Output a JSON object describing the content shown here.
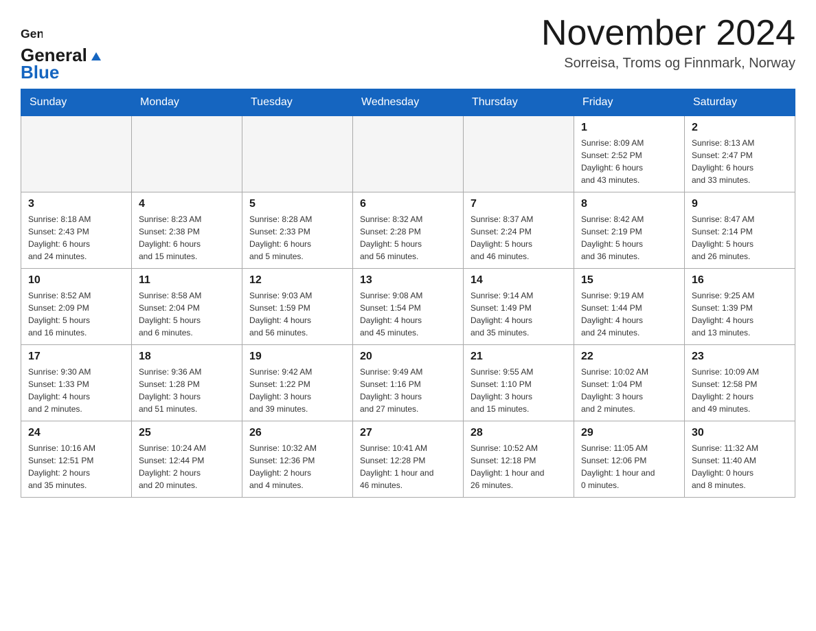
{
  "header": {
    "logo_general": "General",
    "logo_blue": "Blue",
    "month_title": "November 2024",
    "subtitle": "Sorreisa, Troms og Finnmark, Norway"
  },
  "weekdays": [
    "Sunday",
    "Monday",
    "Tuesday",
    "Wednesday",
    "Thursday",
    "Friday",
    "Saturday"
  ],
  "weeks": [
    {
      "days": [
        {
          "num": "",
          "info": "",
          "empty": true
        },
        {
          "num": "",
          "info": "",
          "empty": true
        },
        {
          "num": "",
          "info": "",
          "empty": true
        },
        {
          "num": "",
          "info": "",
          "empty": true
        },
        {
          "num": "",
          "info": "",
          "empty": true
        },
        {
          "num": "1",
          "info": "Sunrise: 8:09 AM\nSunset: 2:52 PM\nDaylight: 6 hours\nand 43 minutes.",
          "empty": false
        },
        {
          "num": "2",
          "info": "Sunrise: 8:13 AM\nSunset: 2:47 PM\nDaylight: 6 hours\nand 33 minutes.",
          "empty": false
        }
      ]
    },
    {
      "days": [
        {
          "num": "3",
          "info": "Sunrise: 8:18 AM\nSunset: 2:43 PM\nDaylight: 6 hours\nand 24 minutes.",
          "empty": false
        },
        {
          "num": "4",
          "info": "Sunrise: 8:23 AM\nSunset: 2:38 PM\nDaylight: 6 hours\nand 15 minutes.",
          "empty": false
        },
        {
          "num": "5",
          "info": "Sunrise: 8:28 AM\nSunset: 2:33 PM\nDaylight: 6 hours\nand 5 minutes.",
          "empty": false
        },
        {
          "num": "6",
          "info": "Sunrise: 8:32 AM\nSunset: 2:28 PM\nDaylight: 5 hours\nand 56 minutes.",
          "empty": false
        },
        {
          "num": "7",
          "info": "Sunrise: 8:37 AM\nSunset: 2:24 PM\nDaylight: 5 hours\nand 46 minutes.",
          "empty": false
        },
        {
          "num": "8",
          "info": "Sunrise: 8:42 AM\nSunset: 2:19 PM\nDaylight: 5 hours\nand 36 minutes.",
          "empty": false
        },
        {
          "num": "9",
          "info": "Sunrise: 8:47 AM\nSunset: 2:14 PM\nDaylight: 5 hours\nand 26 minutes.",
          "empty": false
        }
      ]
    },
    {
      "days": [
        {
          "num": "10",
          "info": "Sunrise: 8:52 AM\nSunset: 2:09 PM\nDaylight: 5 hours\nand 16 minutes.",
          "empty": false
        },
        {
          "num": "11",
          "info": "Sunrise: 8:58 AM\nSunset: 2:04 PM\nDaylight: 5 hours\nand 6 minutes.",
          "empty": false
        },
        {
          "num": "12",
          "info": "Sunrise: 9:03 AM\nSunset: 1:59 PM\nDaylight: 4 hours\nand 56 minutes.",
          "empty": false
        },
        {
          "num": "13",
          "info": "Sunrise: 9:08 AM\nSunset: 1:54 PM\nDaylight: 4 hours\nand 45 minutes.",
          "empty": false
        },
        {
          "num": "14",
          "info": "Sunrise: 9:14 AM\nSunset: 1:49 PM\nDaylight: 4 hours\nand 35 minutes.",
          "empty": false
        },
        {
          "num": "15",
          "info": "Sunrise: 9:19 AM\nSunset: 1:44 PM\nDaylight: 4 hours\nand 24 minutes.",
          "empty": false
        },
        {
          "num": "16",
          "info": "Sunrise: 9:25 AM\nSunset: 1:39 PM\nDaylight: 4 hours\nand 13 minutes.",
          "empty": false
        }
      ]
    },
    {
      "days": [
        {
          "num": "17",
          "info": "Sunrise: 9:30 AM\nSunset: 1:33 PM\nDaylight: 4 hours\nand 2 minutes.",
          "empty": false
        },
        {
          "num": "18",
          "info": "Sunrise: 9:36 AM\nSunset: 1:28 PM\nDaylight: 3 hours\nand 51 minutes.",
          "empty": false
        },
        {
          "num": "19",
          "info": "Sunrise: 9:42 AM\nSunset: 1:22 PM\nDaylight: 3 hours\nand 39 minutes.",
          "empty": false
        },
        {
          "num": "20",
          "info": "Sunrise: 9:49 AM\nSunset: 1:16 PM\nDaylight: 3 hours\nand 27 minutes.",
          "empty": false
        },
        {
          "num": "21",
          "info": "Sunrise: 9:55 AM\nSunset: 1:10 PM\nDaylight: 3 hours\nand 15 minutes.",
          "empty": false
        },
        {
          "num": "22",
          "info": "Sunrise: 10:02 AM\nSunset: 1:04 PM\nDaylight: 3 hours\nand 2 minutes.",
          "empty": false
        },
        {
          "num": "23",
          "info": "Sunrise: 10:09 AM\nSunset: 12:58 PM\nDaylight: 2 hours\nand 49 minutes.",
          "empty": false
        }
      ]
    },
    {
      "days": [
        {
          "num": "24",
          "info": "Sunrise: 10:16 AM\nSunset: 12:51 PM\nDaylight: 2 hours\nand 35 minutes.",
          "empty": false
        },
        {
          "num": "25",
          "info": "Sunrise: 10:24 AM\nSunset: 12:44 PM\nDaylight: 2 hours\nand 20 minutes.",
          "empty": false
        },
        {
          "num": "26",
          "info": "Sunrise: 10:32 AM\nSunset: 12:36 PM\nDaylight: 2 hours\nand 4 minutes.",
          "empty": false
        },
        {
          "num": "27",
          "info": "Sunrise: 10:41 AM\nSunset: 12:28 PM\nDaylight: 1 hour and\n46 minutes.",
          "empty": false
        },
        {
          "num": "28",
          "info": "Sunrise: 10:52 AM\nSunset: 12:18 PM\nDaylight: 1 hour and\n26 minutes.",
          "empty": false
        },
        {
          "num": "29",
          "info": "Sunrise: 11:05 AM\nSunset: 12:06 PM\nDaylight: 1 hour and\n0 minutes.",
          "empty": false
        },
        {
          "num": "30",
          "info": "Sunrise: 11:32 AM\nSunset: 11:40 AM\nDaylight: 0 hours\nand 8 minutes.",
          "empty": false
        }
      ]
    }
  ]
}
